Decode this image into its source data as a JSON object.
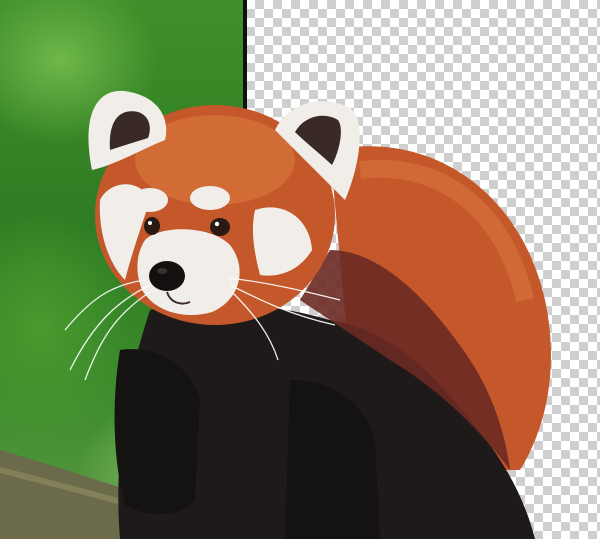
{
  "canvas": {
    "background_left": "#3f8f2a",
    "checker_light": "#ffffff",
    "checker_dark": "#cfcfcf",
    "divider_color": "#111111"
  },
  "subject": {
    "fur_orange": "#c5582a",
    "fur_dark": "#1e1a1a",
    "fur_maroon": "#6b2a24",
    "face_white": "#f1eeea"
  }
}
